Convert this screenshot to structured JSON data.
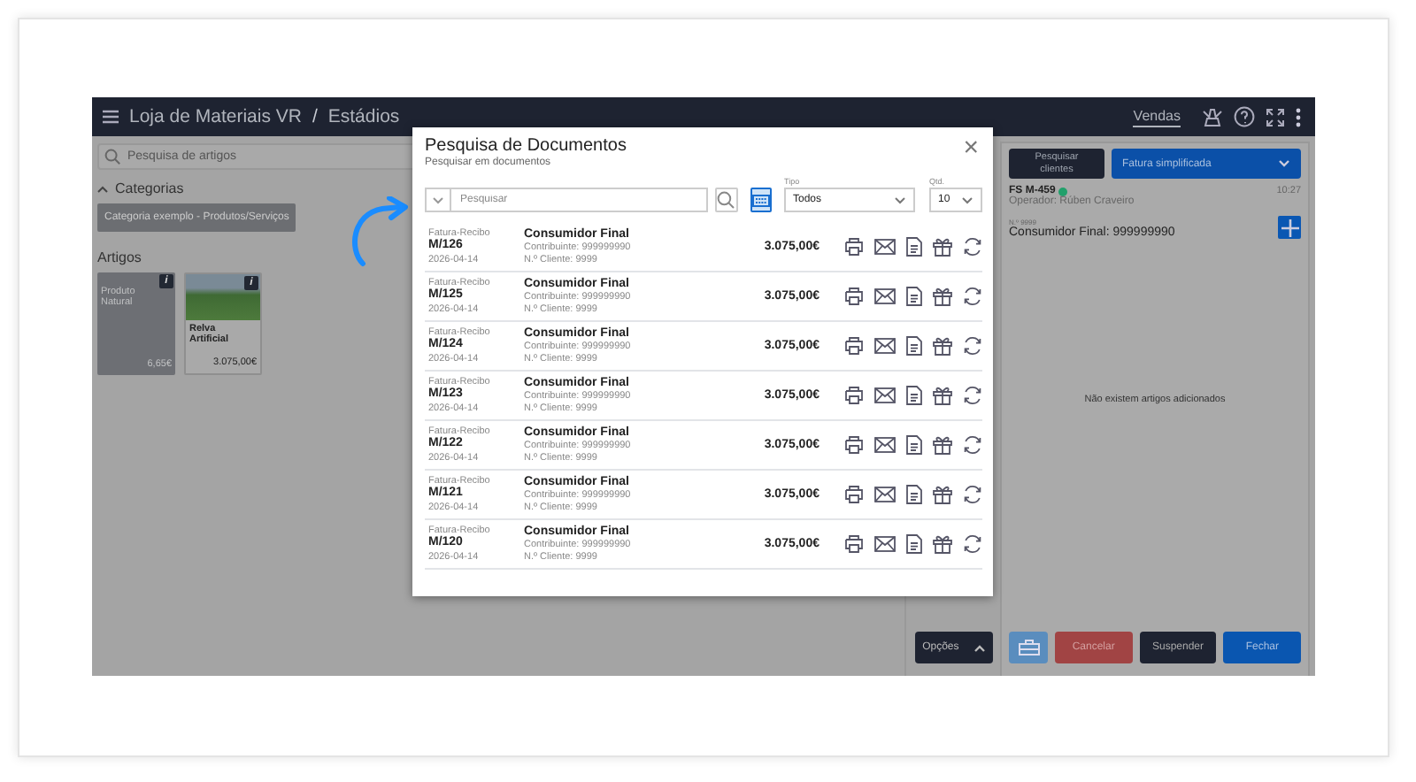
{
  "header": {
    "title": "Loja de Materiais VR",
    "separator": "/",
    "subtitle": "Estádios",
    "nav": [
      {
        "label": "Vendas",
        "selected": true
      }
    ]
  },
  "catalog": {
    "search_placeholder": "Pesquisa de artigos",
    "categories_label": "Categorias",
    "categories_expanded": true,
    "categories": [
      "Categoria exemplo - Produtos/Serviços"
    ],
    "articles_label": "Artigos",
    "articles": [
      {
        "kind": "plain",
        "name": "Produto Natural",
        "price": "6,65€",
        "info": "i"
      },
      {
        "kind": "photo",
        "name": "Relva Artificial",
        "price": "3.075,00€",
        "info": "i"
      }
    ]
  },
  "options_button": "Opções",
  "sale": {
    "search_clients": "Pesquisar clientes",
    "doc_type": "Fatura simplificada",
    "doc_number": "FS M-459",
    "time": "10:27",
    "operator": "Operador: Rúben Craveiro",
    "client_no": "N.º 9999",
    "client": "Consumidor Final: 999999990",
    "empty": "Não existem artigos adicionados",
    "buttons": [
      {
        "kind": "icon"
      },
      {
        "kind": "danger",
        "label": "Cancelar"
      },
      {
        "kind": "dark",
        "label": "Suspender"
      },
      {
        "kind": "primary",
        "label": "Fechar"
      }
    ]
  },
  "modal": {
    "title": "Pesquisa de Documentos",
    "subtitle": "Pesquisar em documentos",
    "close": "×",
    "search_placeholder": "Pesquisar",
    "type_label": "Tipo",
    "type_value": "Todos",
    "qty_label": "Qtd.",
    "qty_value": "10",
    "documents": [
      {
        "type": "Fatura-Recibo",
        "number": "M/126",
        "date": "2026-04-14",
        "client": "Consumidor Final",
        "taxpayer": "Contribuinte: 999999990",
        "client_no": "N.º Cliente: 9999",
        "amount": "3.075,00€"
      },
      {
        "type": "Fatura-Recibo",
        "number": "M/125",
        "date": "2026-04-14",
        "client": "Consumidor Final",
        "taxpayer": "Contribuinte: 999999990",
        "client_no": "N.º Cliente: 9999",
        "amount": "3.075,00€"
      },
      {
        "type": "Fatura-Recibo",
        "number": "M/124",
        "date": "2026-04-14",
        "client": "Consumidor Final",
        "taxpayer": "Contribuinte: 999999990",
        "client_no": "N.º Cliente: 9999",
        "amount": "3.075,00€"
      },
      {
        "type": "Fatura-Recibo",
        "number": "M/123",
        "date": "2026-04-14",
        "client": "Consumidor Final",
        "taxpayer": "Contribuinte: 999999990",
        "client_no": "N.º Cliente: 9999",
        "amount": "3.075,00€"
      },
      {
        "type": "Fatura-Recibo",
        "number": "M/122",
        "date": "2026-04-14",
        "client": "Consumidor Final",
        "taxpayer": "Contribuinte: 999999990",
        "client_no": "N.º Cliente: 9999",
        "amount": "3.075,00€"
      },
      {
        "type": "Fatura-Recibo",
        "number": "M/121",
        "date": "2026-04-14",
        "client": "Consumidor Final",
        "taxpayer": "Contribuinte: 999999990",
        "client_no": "N.º Cliente: 9999",
        "amount": "3.075,00€"
      },
      {
        "type": "Fatura-Recibo",
        "number": "M/120",
        "date": "2026-04-14",
        "client": "Consumidor Final",
        "taxpayer": "Contribuinte: 999999990",
        "client_no": "N.º Cliente: 9999",
        "amount": "3.075,00€"
      }
    ]
  }
}
